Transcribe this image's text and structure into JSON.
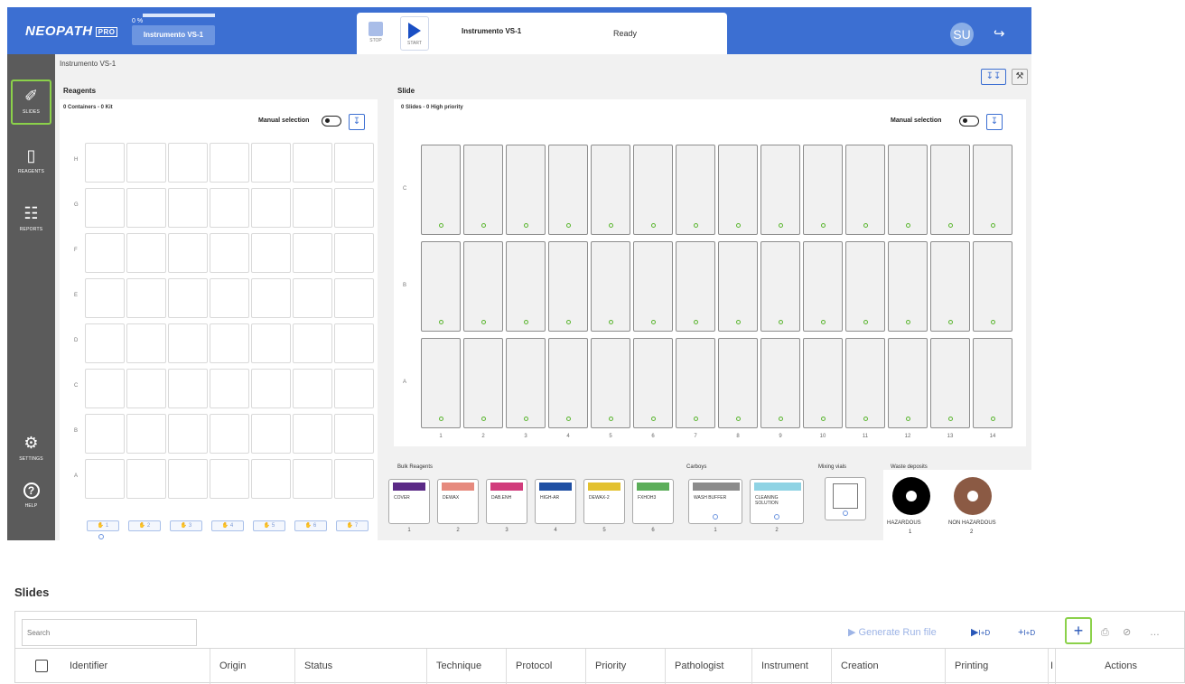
{
  "header": {
    "logo": "NEOPATH",
    "logo_badge": "PRO",
    "progress_label": "0 %",
    "progress_fraction": 0.0,
    "instrument_button": "Instrumento VS-1",
    "stop_label": "STOP",
    "start_label": "START",
    "run_instrument": "Instrumento VS-1",
    "status": "Ready",
    "user_initials": "SU"
  },
  "sidebar": {
    "items": [
      {
        "label": "SLIDES",
        "icon": "slide-icon"
      },
      {
        "label": "REAGENTS",
        "icon": "reagent-bottle-icon"
      },
      {
        "label": "REPORTS",
        "icon": "report-icon"
      },
      {
        "label": "SETTINGS",
        "icon": "gears-icon"
      },
      {
        "label": "HELP",
        "icon": "help-icon"
      }
    ]
  },
  "breadcrumb": "Instrumento VS-1",
  "reagents": {
    "title": "Reagents",
    "summary": "0 Containers - 0 Kit",
    "manual_label": "Manual selection",
    "rows": [
      "H",
      "G",
      "F",
      "E",
      "D",
      "C",
      "B",
      "A"
    ],
    "racks": [
      "1",
      "2",
      "3",
      "4",
      "5",
      "6",
      "7"
    ]
  },
  "slide": {
    "title": "Slide",
    "summary": "0 Slides - 0 High priority",
    "manual_label": "Manual selection",
    "rows": [
      "C",
      "B",
      "A"
    ],
    "columns": [
      "1",
      "2",
      "3",
      "4",
      "5",
      "6",
      "7",
      "8",
      "9",
      "10",
      "11",
      "12",
      "13",
      "14"
    ]
  },
  "bulk": {
    "title": "Bulk Reagents",
    "items": [
      {
        "label": "COVER",
        "color": "#5b2a86",
        "num": "1"
      },
      {
        "label": "DEWAX",
        "color": "#e68a7e",
        "num": "2"
      },
      {
        "label": "DAB.ENH",
        "color": "#d13c7c",
        "num": "3"
      },
      {
        "label": "HIGH-AR",
        "color": "#1f4fa3",
        "num": "4"
      },
      {
        "label": "DEWAX-2",
        "color": "#e3c12f",
        "num": "5"
      },
      {
        "label": "FXHOH3",
        "color": "#5cae5a",
        "num": "6"
      }
    ]
  },
  "carboys": {
    "title": "Carboys",
    "items": [
      {
        "label": "WASH BUFFER",
        "color": "#8c8c8c",
        "num": "1"
      },
      {
        "label": "CLEANING SOLUTION",
        "color": "#8fd3e4",
        "num": "2"
      }
    ]
  },
  "mixing": {
    "title": "Mixing vials"
  },
  "waste": {
    "title": "Waste deposits",
    "items": [
      {
        "label": "HAZARDOUS",
        "color": "#000000",
        "num": "1"
      },
      {
        "label": "NON HAZARDOUS",
        "color": "#8b5a44",
        "num": "2"
      }
    ]
  },
  "slides_list": {
    "title": "Slides",
    "search_placeholder": "Search",
    "generate_label": "Generate Run file",
    "play_id_label": "I+D",
    "add_id_label": "I+D",
    "columns": [
      "Identifier",
      "Origin",
      "Status",
      "Technique",
      "Protocol",
      "Priority",
      "Pathologist",
      "Instrument",
      "Creation",
      "Printing",
      "I",
      "Actions"
    ]
  }
}
